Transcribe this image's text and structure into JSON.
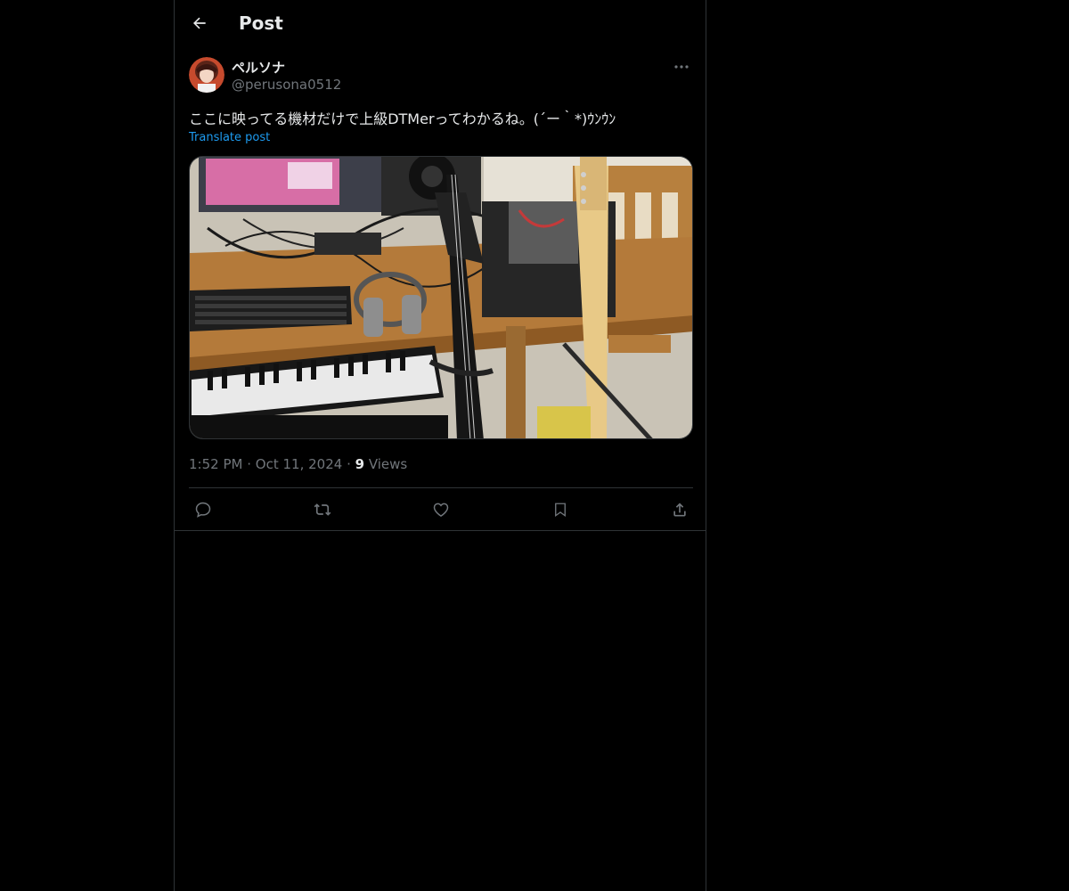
{
  "header": {
    "title": "Post"
  },
  "post": {
    "author": {
      "display_name": "ペルソナ",
      "handle": "@perusona0512"
    },
    "text": "ここに映ってる機材だけで上級DTMerってわかるね。(´ー｀*)ｳﾝｳﾝ",
    "translate_label": "Translate post",
    "time": "1:52 PM",
    "date": "Oct 11, 2024",
    "views_count": "9",
    "views_label": "Views"
  },
  "icons": {
    "back": "arrow-left-icon",
    "more": "more-horizontal-icon",
    "reply": "reply-icon",
    "repost": "repost-icon",
    "like": "heart-icon",
    "bookmark": "bookmark-icon",
    "share": "share-icon"
  },
  "colors": {
    "background": "#000000",
    "text": "#e7e9ea",
    "muted": "#71767b",
    "link": "#1d9bf0",
    "border": "#2f3336"
  }
}
